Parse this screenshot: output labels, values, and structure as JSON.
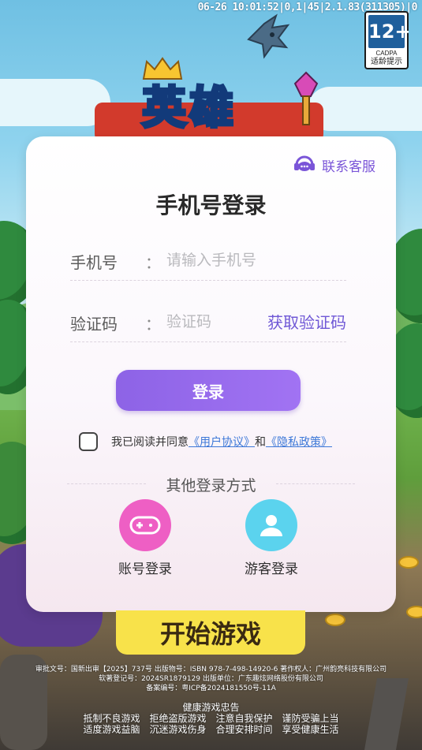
{
  "status_bar": {
    "text": "06-26 10:01:52|0,1|45|2.1.83(311305)|0"
  },
  "age_badge": {
    "rating": "12+",
    "org": "CADPA",
    "tip": "适龄提示"
  },
  "logo": {
    "title": "英雄"
  },
  "support": {
    "label": "联系客服",
    "icon": "headset-chat-icon"
  },
  "login": {
    "title": "手机号登录",
    "phone_label": "手机号",
    "phone_placeholder": "请输入手机号",
    "code_label": "验证码",
    "code_placeholder": "验证码",
    "colon": "：",
    "get_code": "获取验证码",
    "submit": "登录"
  },
  "agreement": {
    "prefix": "我已阅读并同意",
    "user_agreement": "《用户协议》",
    "and": "和",
    "privacy": "《隐私政策》"
  },
  "other_methods": {
    "title": "其他登录方式",
    "items": [
      {
        "label": "账号登录",
        "icon": "gamepad-icon",
        "color": "#ee5fc4"
      },
      {
        "label": "游客登录",
        "icon": "user-icon",
        "color": "#5bd3ee"
      }
    ]
  },
  "start_game": {
    "label": "开始游戏"
  },
  "legal": {
    "line1": "审批文号：国新出审【2025】737号 出版物号：ISBN 978-7-498-14920-6 著作权人：广州韵亮科技有限公司",
    "line2": "软著登记号：2024SR1879129 出版单位：广东趣炫网络股份有限公司",
    "line3": "备案编号：粤ICP备2024181550号-11A"
  },
  "health": {
    "title": "健康游戏忠告",
    "row1": [
      "抵制不良游戏",
      "拒绝盗版游戏",
      "注意自我保护",
      "谨防受骗上当"
    ],
    "row2": [
      "适度游戏益脑",
      "沉迷游戏伤身",
      "合理安排时间",
      "享受健康生活"
    ]
  },
  "colors": {
    "accent": "#8d63e6",
    "link": "#3d78d8",
    "start_button": "#f8e24a"
  }
}
